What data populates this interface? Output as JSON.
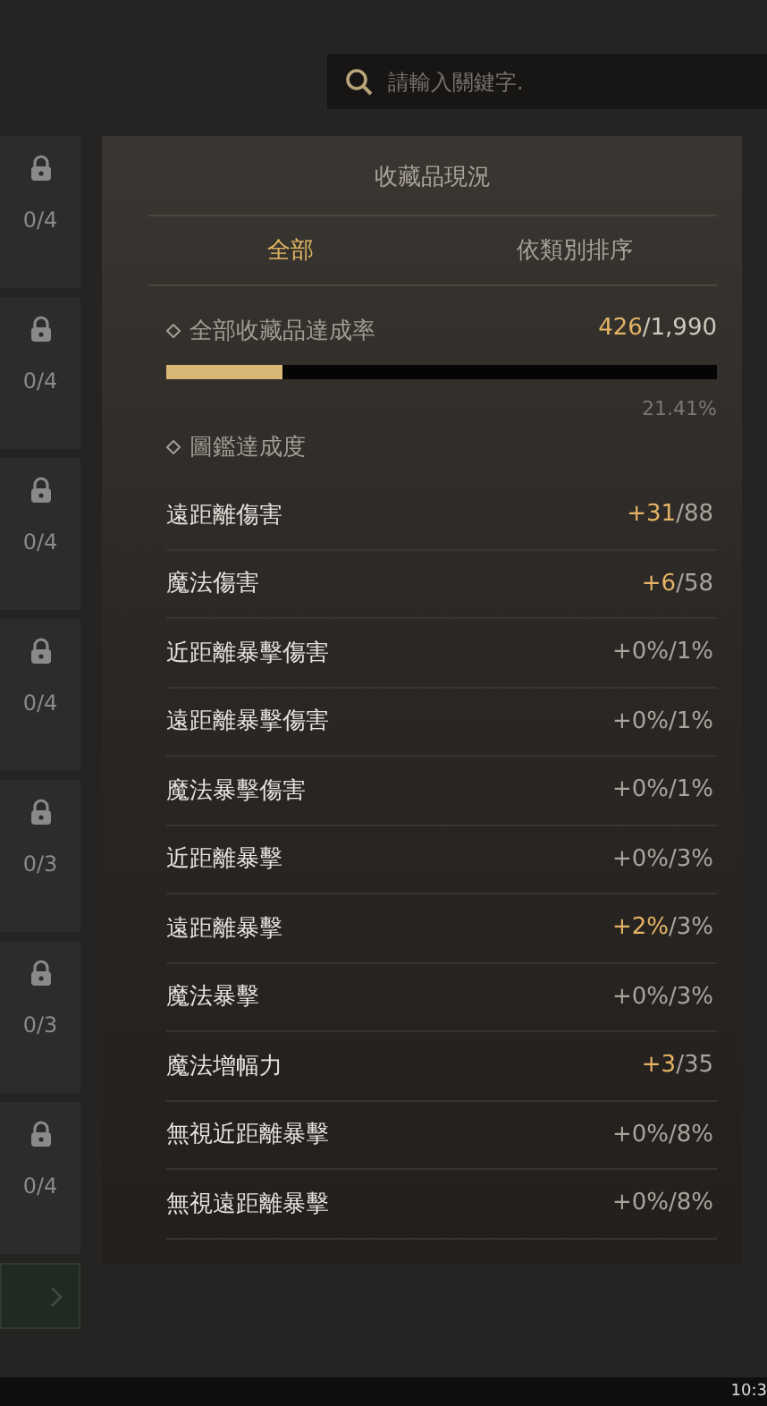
{
  "search": {
    "placeholder": "請輸入關鍵字."
  },
  "side_cards": [
    {
      "locked": true,
      "count": "0/4"
    },
    {
      "locked": true,
      "count": "0/4"
    },
    {
      "locked": true,
      "count": "0/4"
    },
    {
      "locked": true,
      "count": "0/4"
    },
    {
      "locked": true,
      "count": "0/3"
    },
    {
      "locked": true,
      "count": "0/3"
    },
    {
      "locked": true,
      "count": "0/4"
    }
  ],
  "panel": {
    "title": "收藏品現況",
    "tabs": [
      {
        "label": "全部",
        "selected": true
      },
      {
        "label": "依類別排序",
        "selected": false
      }
    ],
    "overall": {
      "label": "全部收藏品達成率",
      "current": "426",
      "total": "/1,990",
      "level": 0.21,
      "percent": "21.41%"
    },
    "section": "圖鑑達成度",
    "stats": [
      {
        "name": "遠距離傷害",
        "gain": "+31",
        "max": "/88",
        "highlighted": true
      },
      {
        "name": "魔法傷害",
        "gain": "+6",
        "max": "/58",
        "highlighted": true
      },
      {
        "name": "近距離暴擊傷害",
        "gain": "+0%",
        "max": "/1%",
        "highlighted": false
      },
      {
        "name": "遠距離暴擊傷害",
        "gain": "+0%",
        "max": "/1%",
        "highlighted": false
      },
      {
        "name": "魔法暴擊傷害",
        "gain": "+0%",
        "max": "/1%",
        "highlighted": false
      },
      {
        "name": "近距離暴擊",
        "gain": "+0%",
        "max": "/3%",
        "highlighted": false
      },
      {
        "name": "遠距離暴擊",
        "gain": "+2%",
        "max": "/3%",
        "highlighted": true
      },
      {
        "name": "魔法暴擊",
        "gain": "+0%",
        "max": "/3%",
        "highlighted": false
      },
      {
        "name": "魔法增幅力",
        "gain": "+3",
        "max": "/35",
        "highlighted": true
      },
      {
        "name": "無視近距離暴擊",
        "gain": "+0%",
        "max": "/8%",
        "highlighted": false
      },
      {
        "name": "無視遠距離暴擊",
        "gain": "+0%",
        "max": "/8%",
        "highlighted": false
      }
    ]
  },
  "taskbar": {
    "clock": "10:3"
  }
}
